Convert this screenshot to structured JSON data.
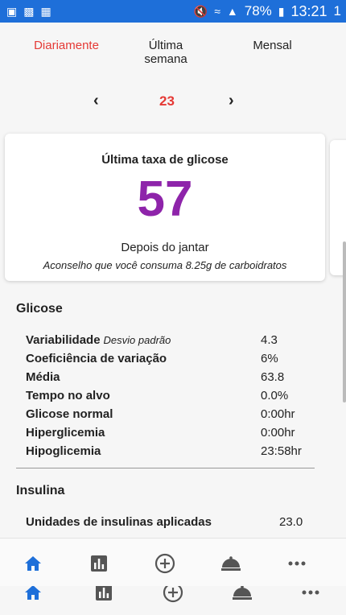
{
  "status_bar": {
    "battery": "78%",
    "time": "13:21",
    "overflow": "1"
  },
  "tabs": [
    {
      "label": "Diariamente",
      "active": true
    },
    {
      "label": "Última semana",
      "active": false
    },
    {
      "label": "Mensal",
      "active": false
    }
  ],
  "day_nav": {
    "prev": "‹",
    "day": "23",
    "next": "›"
  },
  "card": {
    "title": "Última taxa de glicose",
    "value": "57",
    "meal": "Depois do jantar",
    "advice": "Aconselho que você consuma 8.25g de carboidratos"
  },
  "glucose": {
    "heading": "Glicose",
    "rows": [
      {
        "label": "Variabilidade",
        "sub": "Desvio padrão",
        "value": "4.3"
      },
      {
        "label": "Coeficiência de variação",
        "sub": "",
        "value": "6%"
      },
      {
        "label": "Média",
        "sub": "",
        "value": "63.8"
      },
      {
        "label": "Tempo no alvo",
        "sub": "",
        "value": "0.0%"
      },
      {
        "label": "Glicose normal",
        "sub": "",
        "value": "0:00hr"
      },
      {
        "label": "Hiperglicemia",
        "sub": "",
        "value": "0:00hr"
      },
      {
        "label": "Hipoglicemia",
        "sub": "",
        "value": "23:58hr"
      }
    ]
  },
  "insulin": {
    "heading": "Insulina",
    "rows": [
      {
        "label": "Unidades de insulinas aplicadas",
        "value": "23.0"
      }
    ]
  },
  "bottom_nav": [
    {
      "icon": "home-icon",
      "active": true
    },
    {
      "icon": "chart-icon",
      "active": false
    },
    {
      "icon": "add-icon",
      "active": false
    },
    {
      "icon": "meal-icon",
      "active": false
    },
    {
      "icon": "more-icon",
      "active": false
    }
  ],
  "colors": {
    "accent": "#e53935",
    "value": "#8e24aa",
    "nav_active": "#1e6fd9",
    "status_bar": "#1e6fd9"
  }
}
